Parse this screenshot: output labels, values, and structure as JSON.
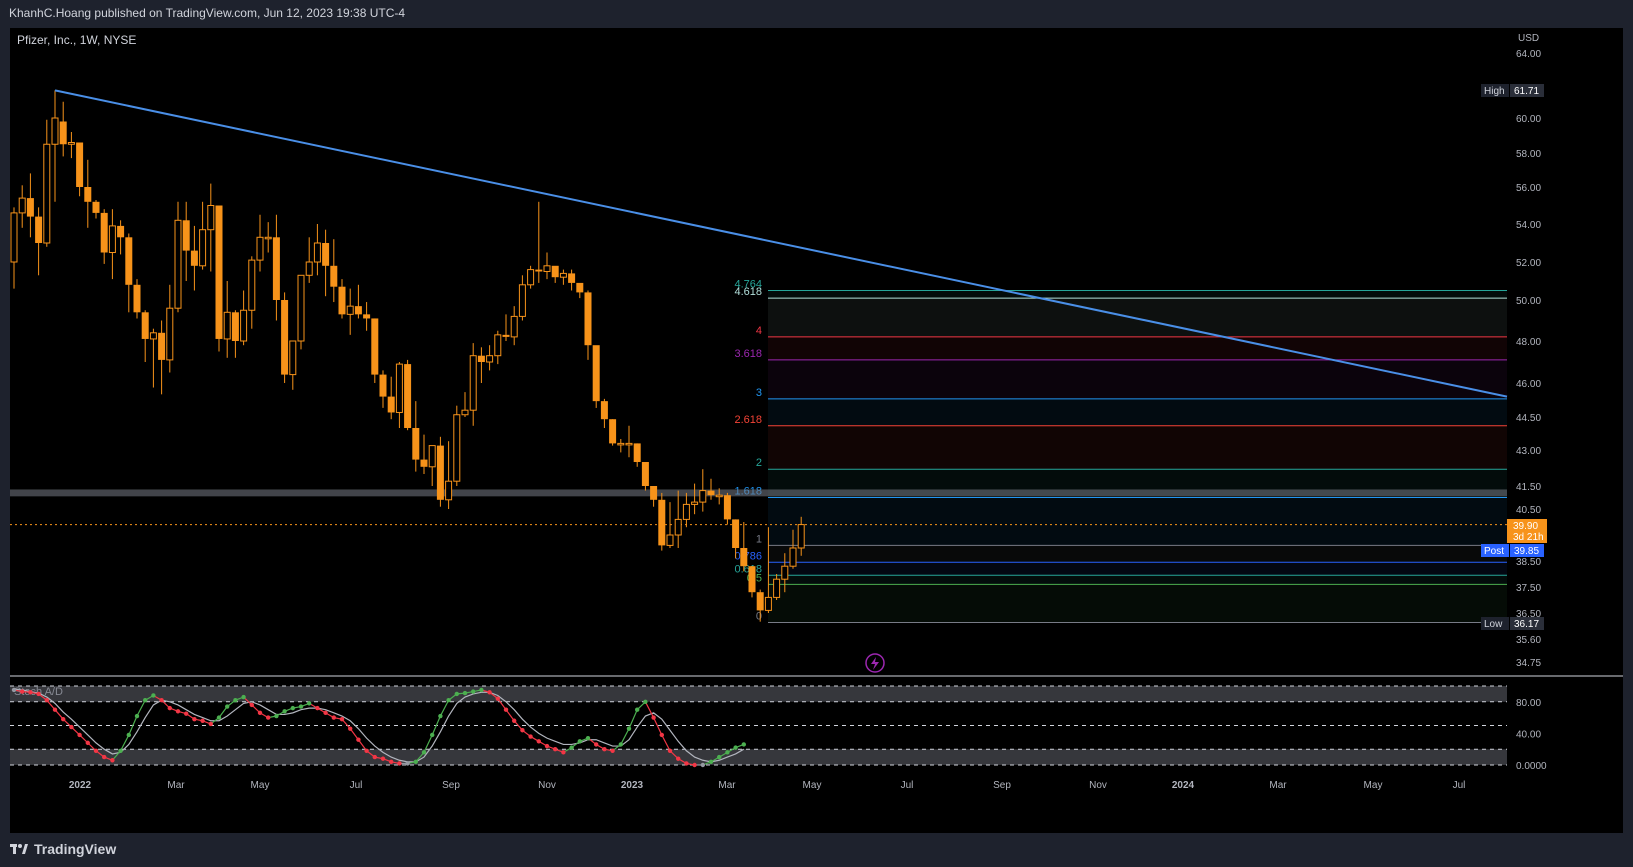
{
  "header": {
    "published_by": "KhanhC.Hoang published on TradingView.com, Jun 12, 2023 19:38 UTC-4"
  },
  "footer": {
    "brand": "TradingView"
  },
  "chart_data": {
    "type": "candlestick",
    "title": "Pfizer, Inc., 1W, NYSE",
    "currency": "USD",
    "price_axis_ticks": [
      "64.00",
      "60.00",
      "58.00",
      "56.00",
      "54.00",
      "52.00",
      "50.00",
      "48.00",
      "46.00",
      "44.50",
      "43.00",
      "41.50",
      "40.50",
      "38.50",
      "37.50",
      "36.50",
      "35.60",
      "34.75"
    ],
    "price_tick_values": [
      64.0,
      60.0,
      58.0,
      56.0,
      54.0,
      52.0,
      50.0,
      48.0,
      46.0,
      44.5,
      43.0,
      41.5,
      40.5,
      38.5,
      37.5,
      36.5,
      35.6,
      34.75
    ],
    "time_axis_ticks": [
      "2022",
      "Mar",
      "May",
      "Jul",
      "Sep",
      "Nov",
      "2023",
      "Mar",
      "May",
      "Jul",
      "Sep",
      "Nov",
      "2024",
      "Mar",
      "May",
      "Jul"
    ],
    "badges": {
      "high_label": "High",
      "high_value": "61.71",
      "post_label": "Post",
      "post_value": "39.85",
      "low_label": "Low",
      "low_value": "36.17",
      "last_value": "39.90",
      "countdown": "3d 21h"
    },
    "candle_color": "#f7931a",
    "candles": [
      [
        52.0,
        54.6,
        50.6,
        54.9
      ],
      [
        54.6,
        55.4,
        53.8,
        56.1
      ],
      [
        55.4,
        54.4,
        53.3,
        56.8
      ],
      [
        54.4,
        53.0,
        51.3,
        54.9
      ],
      [
        53.0,
        58.5,
        52.8,
        59.9
      ],
      [
        58.5,
        60.0,
        55.2,
        61.7
      ],
      [
        59.8,
        58.5,
        57.8,
        61.0
      ],
      [
        58.5,
        58.6,
        57.7,
        59.2
      ],
      [
        58.6,
        56.0,
        55.5,
        58.6
      ],
      [
        56.0,
        55.2,
        53.8,
        57.6
      ],
      [
        55.2,
        54.6,
        54.3,
        55.3
      ],
      [
        54.6,
        52.5,
        51.9,
        54.8
      ],
      [
        52.5,
        53.9,
        51.1,
        54.8
      ],
      [
        53.9,
        53.3,
        52.4,
        54.2
      ],
      [
        53.3,
        50.8,
        49.4,
        53.5
      ],
      [
        50.8,
        49.4,
        49.1,
        51.1
      ],
      [
        49.4,
        48.1,
        47.0,
        49.5
      ],
      [
        48.1,
        48.4,
        45.8,
        48.6
      ],
      [
        48.4,
        47.1,
        45.5,
        49.0
      ],
      [
        47.1,
        49.6,
        46.5,
        50.8
      ],
      [
        49.6,
        54.2,
        49.4,
        55.2
      ],
      [
        54.2,
        52.6,
        51.0,
        55.2
      ],
      [
        52.6,
        51.8,
        50.5,
        53.9
      ],
      [
        51.8,
        53.7,
        51.6,
        55.2
      ],
      [
        53.7,
        55.0,
        51.5,
        56.2
      ],
      [
        55.0,
        48.1,
        47.5,
        55.0
      ],
      [
        48.1,
        49.4,
        47.2,
        51.0
      ],
      [
        49.4,
        48.0,
        47.2,
        49.5
      ],
      [
        48.0,
        49.5,
        47.8,
        50.5
      ],
      [
        49.5,
        52.1,
        48.6,
        52.3
      ],
      [
        52.1,
        53.3,
        51.5,
        54.5
      ],
      [
        53.3,
        53.3,
        52.5,
        54.1
      ],
      [
        53.3,
        50.0,
        49.0,
        54.5
      ],
      [
        50.0,
        46.4,
        46.0,
        50.4
      ],
      [
        46.4,
        48.0,
        45.7,
        48.0
      ],
      [
        48.0,
        51.3,
        47.6,
        51.3
      ],
      [
        51.3,
        52.0,
        50.9,
        53.3
      ],
      [
        52.0,
        53.0,
        51.3,
        54.0
      ],
      [
        53.0,
        51.8,
        50.2,
        53.7
      ],
      [
        51.8,
        50.7,
        49.9,
        53.2
      ],
      [
        50.7,
        49.3,
        49.1,
        51.1
      ],
      [
        49.3,
        49.7,
        48.3,
        50.6
      ],
      [
        49.7,
        49.3,
        49.1,
        50.8
      ],
      [
        49.3,
        49.1,
        48.5,
        49.9
      ],
      [
        49.1,
        46.4,
        46.0,
        49.1
      ],
      [
        46.4,
        45.4,
        44.9,
        46.6
      ],
      [
        45.4,
        44.7,
        44.4,
        46.3
      ],
      [
        44.7,
        46.9,
        44.0,
        47.0
      ],
      [
        46.9,
        44.0,
        43.9,
        47.1
      ],
      [
        44.0,
        42.6,
        42.1,
        45.2
      ],
      [
        42.6,
        42.3,
        42.0,
        43.7
      ],
      [
        42.3,
        43.2,
        41.5,
        43.2
      ],
      [
        43.2,
        40.9,
        40.6,
        43.6
      ],
      [
        40.9,
        41.7,
        40.5,
        43.4
      ],
      [
        41.7,
        44.6,
        41.5,
        45.0
      ],
      [
        44.6,
        44.8,
        44.5,
        45.6
      ],
      [
        44.8,
        47.3,
        44.1,
        47.9
      ],
      [
        47.3,
        47.0,
        46.0,
        47.7
      ],
      [
        47.0,
        47.3,
        46.6,
        47.8
      ],
      [
        47.3,
        48.3,
        46.9,
        48.5
      ],
      [
        48.3,
        48.2,
        48.0,
        49.3
      ],
      [
        48.2,
        49.2,
        47.8,
        49.7
      ],
      [
        49.2,
        50.8,
        49.0,
        51.3
      ],
      [
        50.8,
        51.6,
        50.6,
        51.8
      ],
      [
        51.6,
        51.5,
        50.9,
        55.2
      ],
      [
        51.5,
        51.8,
        51.1,
        52.5
      ],
      [
        51.8,
        51.2,
        50.9,
        51.7
      ],
      [
        51.2,
        51.4,
        50.8,
        51.6
      ],
      [
        51.4,
        50.9,
        50.5,
        51.6
      ],
      [
        50.9,
        50.4,
        50.1,
        50.8
      ],
      [
        50.4,
        47.8,
        47.1,
        50.5
      ],
      [
        47.8,
        45.2,
        44.9,
        47.7
      ],
      [
        45.2,
        44.4,
        44.0,
        45.3
      ],
      [
        44.4,
        43.3,
        43.2,
        44.4
      ],
      [
        43.3,
        43.3,
        42.9,
        43.5
      ],
      [
        43.3,
        43.3,
        42.7,
        44.1
      ],
      [
        43.3,
        42.5,
        42.3,
        43.3
      ],
      [
        42.5,
        41.5,
        41.3,
        42.4
      ],
      [
        41.5,
        40.9,
        40.6,
        41.4
      ],
      [
        40.9,
        39.1,
        38.9,
        41.2
      ],
      [
        39.1,
        39.5,
        39.0,
        40.8
      ],
      [
        39.5,
        40.1,
        39.0,
        41.3
      ],
      [
        40.1,
        40.7,
        39.8,
        41.2
      ],
      [
        40.7,
        40.8,
        40.3,
        41.6
      ],
      [
        40.8,
        41.3,
        40.4,
        42.2
      ],
      [
        41.3,
        41.1,
        40.9,
        41.8
      ],
      [
        41.1,
        41.1,
        40.7,
        41.4
      ],
      [
        41.1,
        40.1,
        39.9,
        41.2
      ],
      [
        40.1,
        39.0,
        38.6,
        40.1
      ],
      [
        39.0,
        38.3,
        38.1,
        40.0
      ],
      [
        38.3,
        37.3,
        37.1,
        38.3
      ],
      [
        37.3,
        36.6,
        36.2,
        37.4
      ],
      [
        36.6,
        37.1,
        36.5,
        39.8
      ],
      [
        37.1,
        37.8,
        37.0,
        38.0
      ],
      [
        37.8,
        38.3,
        37.3,
        38.8
      ],
      [
        38.3,
        39.0,
        38.2,
        39.7
      ],
      [
        39.0,
        39.9,
        38.7,
        40.2
      ]
    ],
    "fib_levels": [
      {
        "label": "4.764",
        "price": 50.5,
        "color": "#26a69a"
      },
      {
        "label": "4.618",
        "price": 50.1,
        "color": "#b2dfdb"
      },
      {
        "label": "4",
        "price": 48.2,
        "color": "#f23645"
      },
      {
        "label": "3.618",
        "price": 47.1,
        "color": "#9c27b0"
      },
      {
        "label": "3",
        "price": 45.3,
        "color": "#2196f3"
      },
      {
        "label": "2.618",
        "price": 44.1,
        "color": "#f44336"
      },
      {
        "label": "2",
        "price": 42.2,
        "color": "#26a69a"
      },
      {
        "label": "1.618",
        "price": 41.0,
        "color": "#2196f3"
      },
      {
        "label": "1",
        "price": 39.1,
        "color": "#787b86"
      },
      {
        "label": "0.786",
        "price": 38.45,
        "color": "#2962ff"
      },
      {
        "label": "0.618",
        "price": 37.95,
        "color": "#26a69a"
      },
      {
        "label": "0.5",
        "price": 37.6,
        "color": "#4caf50"
      },
      {
        "label": "0",
        "price": 36.17,
        "color": "#787b86"
      }
    ],
    "trendline": {
      "from_price": 61.7,
      "to_price": 45.4,
      "color": "#4a8fe7"
    },
    "support_zone": {
      "low": 41.05,
      "high": 41.35,
      "color": "#787b86"
    },
    "indicator": {
      "name": "Stoch A/D",
      "ticks": [
        "80.00",
        "40.00",
        "0.0000"
      ],
      "tick_values": [
        80,
        40,
        0
      ],
      "bands": [
        100,
        80,
        50,
        20,
        0
      ],
      "k": [
        95,
        93,
        92,
        90,
        82,
        70,
        58,
        48,
        38,
        28,
        18,
        10,
        6,
        18,
        38,
        62,
        82,
        88,
        82,
        72,
        68,
        65,
        58,
        56,
        52,
        60,
        74,
        82,
        86,
        76,
        66,
        60,
        62,
        68,
        72,
        74,
        78,
        72,
        66,
        60,
        58,
        46,
        32,
        18,
        10,
        8,
        4,
        2,
        2,
        4,
        16,
        38,
        62,
        82,
        90,
        91,
        93,
        95,
        92,
        84,
        70,
        56,
        44,
        36,
        30,
        24,
        20,
        16,
        22,
        30,
        34,
        26,
        20,
        18,
        26,
        46,
        70,
        80,
        60,
        38,
        18,
        8,
        2,
        0,
        0,
        4,
        10,
        16,
        22,
        26
      ],
      "d": [
        96,
        95,
        93,
        91,
        86,
        78,
        67,
        58,
        48,
        38,
        28,
        20,
        14,
        16,
        26,
        42,
        60,
        76,
        82,
        80,
        76,
        70,
        64,
        60,
        56,
        56,
        62,
        70,
        78,
        80,
        76,
        70,
        64,
        64,
        66,
        70,
        72,
        72,
        70,
        66,
        62,
        56,
        46,
        34,
        24,
        16,
        10,
        6,
        4,
        4,
        10,
        24,
        42,
        62,
        78,
        86,
        90,
        92,
        92,
        88,
        80,
        70,
        58,
        48,
        40,
        34,
        30,
        26,
        26,
        28,
        32,
        32,
        28,
        24,
        24,
        32,
        48,
        62,
        66,
        58,
        44,
        30,
        18,
        10,
        6,
        4,
        6,
        10,
        14,
        20
      ],
      "colors": {
        "up": "#4caf50",
        "down": "#f23645",
        "neutral": "#9598a1",
        "line": "#b2b5be"
      }
    }
  }
}
